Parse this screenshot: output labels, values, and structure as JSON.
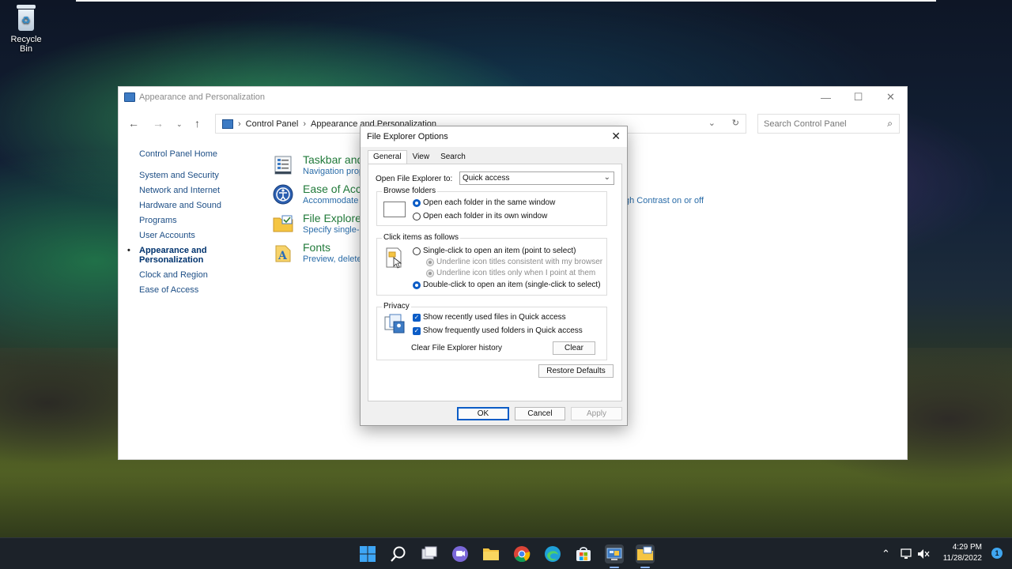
{
  "desktop": {
    "recycle_bin": "Recycle Bin"
  },
  "control_panel": {
    "title": "Appearance and Personalization",
    "breadcrumb": [
      "Control Panel",
      "Appearance and Personalization"
    ],
    "search_placeholder": "Search Control Panel",
    "sidebar": {
      "home": "Control Panel Home",
      "items": [
        "System and Security",
        "Network and Internet",
        "Hardware and Sound",
        "Programs",
        "User Accounts"
      ],
      "active_line1": "Appearance and",
      "active_line2": "Personalization",
      "items_after": [
        "Clock and Region",
        "Ease of Access"
      ]
    },
    "categories": [
      {
        "title": "Taskbar and",
        "sub": "Navigation prop"
      },
      {
        "title": "Ease of Acce",
        "sub": "Accommodate"
      },
      {
        "title": "File Explorer",
        "sub": "Specify single- c"
      },
      {
        "title": "Fonts",
        "sub": "Preview, delete,"
      }
    ],
    "extra_link": "gh Contrast on or off"
  },
  "dialog": {
    "title": "File Explorer Options",
    "tabs": [
      "General",
      "View",
      "Search"
    ],
    "open_to_label": "Open File Explorer to:",
    "open_to_value": "Quick access",
    "browse_title": "Browse folders",
    "browse_same": "Open each folder in the same window",
    "browse_own": "Open each folder in its own window",
    "click_title": "Click items as follows",
    "single_click": "Single-click to open an item (point to select)",
    "underline_browser": "Underline icon titles consistent with my browser",
    "underline_point": "Underline icon titles only when I point at them",
    "double_click": "Double-click to open an item (single-click to select)",
    "privacy_title": "Privacy",
    "show_recent": "Show recently used files in Quick access",
    "show_frequent": "Show frequently used folders in Quick access",
    "clear_history_label": "Clear File Explorer history",
    "clear_btn": "Clear",
    "restore_btn": "Restore Defaults",
    "ok_btn": "OK",
    "cancel_btn": "Cancel",
    "apply_btn": "Apply"
  },
  "taskbar": {
    "time": "4:29 PM",
    "date": "11/28/2022",
    "notifications": "1"
  },
  "colors": {
    "accent": "#0b5cc6",
    "link": "#2a6ca8",
    "category_title": "#217a3a"
  }
}
